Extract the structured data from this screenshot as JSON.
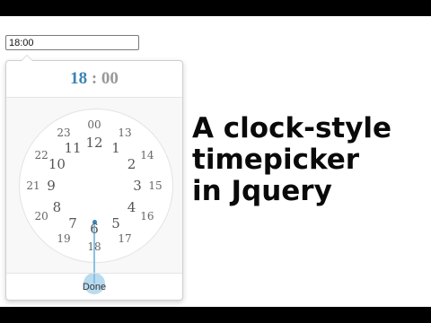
{
  "input": {
    "value": "18:00"
  },
  "timepicker": {
    "hours": "18",
    "separator": ":",
    "minutes": "00",
    "selected_hour": "18",
    "outer_ticks": [
      "00",
      "13",
      "14",
      "15",
      "16",
      "17",
      "18",
      "19",
      "20",
      "21",
      "22",
      "23"
    ],
    "inner_ticks": [
      "12",
      "1",
      "2",
      "3",
      "4",
      "5",
      "6",
      "7",
      "8",
      "9",
      "10",
      "11"
    ],
    "done_label": "Done",
    "accent_color": "#3a83b4",
    "highlight_color": "#b9dbf0"
  },
  "headline": {
    "line1": "A clock-style",
    "line2": "timepicker",
    "line3": "in Jquery"
  }
}
